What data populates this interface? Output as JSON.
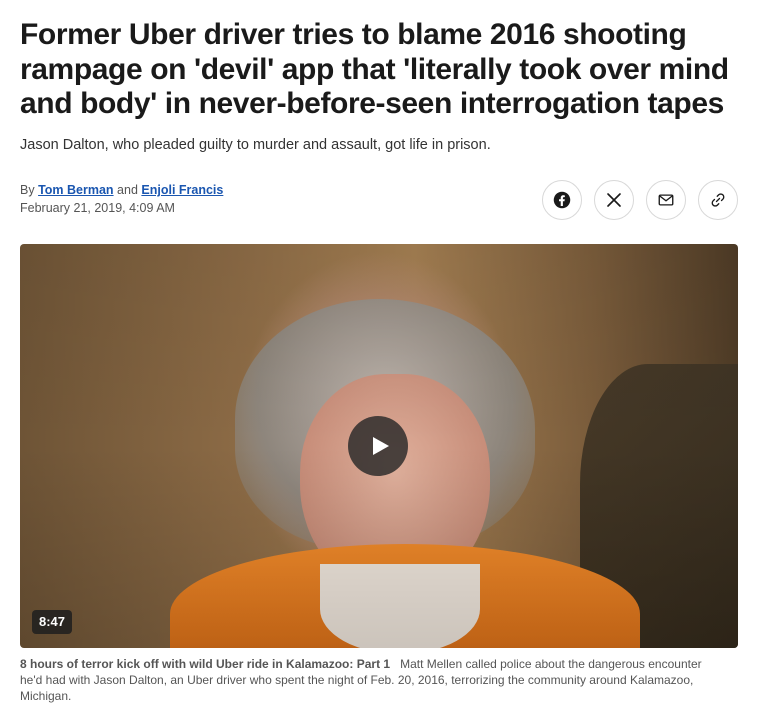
{
  "article": {
    "headline": "Former Uber driver tries to blame 2016 shooting rampage on 'devil' app that 'literally took over mind and body' in never-before-seen interrogation tapes",
    "subhead": "Jason Dalton, who pleaded guilty to murder and assault, got life in prison.",
    "byline": {
      "prefix": "By",
      "author1": "Tom Berman",
      "conjunction": "and",
      "author2": "Enjoli Francis"
    },
    "date": "February 21, 2019, 4:09 AM"
  },
  "share": {
    "buttons": [
      {
        "name": "facebook",
        "icon": "facebook-icon"
      },
      {
        "name": "x",
        "icon": "x-icon"
      },
      {
        "name": "email",
        "icon": "mail-icon"
      },
      {
        "name": "copy-link",
        "icon": "link-icon"
      }
    ]
  },
  "video": {
    "duration": "8:47",
    "caption_title": "8 hours of terror kick off with wild Uber ride in Kalamazoo: Part 1",
    "caption_text": "Matt Mellen called police about the dangerous encounter he'd had with Jason Dalton, an Uber driver who spent the night of Feb. 20, 2016, terrorizing the community around Kalamazoo, Michigan."
  },
  "colors": {
    "link": "#1a56b0",
    "text": "#1a1a1a",
    "muted": "#555555"
  }
}
